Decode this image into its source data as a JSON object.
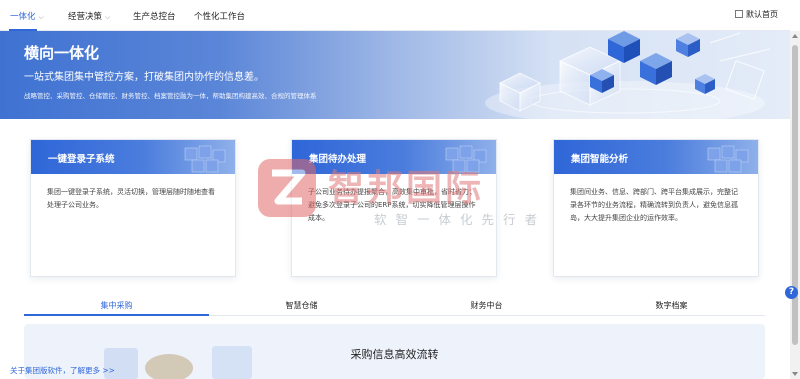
{
  "topnav": {
    "tabs": [
      {
        "label": "一体化",
        "has_dropdown": true,
        "active": true
      },
      {
        "label": "经营决策",
        "has_dropdown": true,
        "active": false
      },
      {
        "label": "生产总控台",
        "has_dropdown": false,
        "active": false
      },
      {
        "label": "个性化工作台",
        "has_dropdown": false,
        "active": false
      }
    ],
    "default_home_label": "默认首页",
    "default_home_checked": false
  },
  "hero": {
    "title": "横向一体化",
    "subtitle": "一站式集团集中管控方案，打破集团内协作的信息差。",
    "description": "战略管控、采购管控、仓储管控、财务管控、档案管控融为一体，帮助集团构建高效、合规的管理体系"
  },
  "cards": [
    {
      "title": "一键登录子系统",
      "text": "集团一键登录子系统，灵活切换，管理层随时随地查看处理子公司业务。"
    },
    {
      "title": "集团待办处理",
      "text": "子公司业务待办提报聚合，高效集中审批，省时省力；避免多次登录子公司的ERP系统，切实降低管理层操作成本。"
    },
    {
      "title": "集团智能分析",
      "text": "集团间业务、信息、跨部门、跨平台集成展示，完整记录各环节的业务流程，精确流转到负责人，避免信息孤岛，大大提升集团企业的运作效率。"
    }
  ],
  "watermark": {
    "brand": "智邦国际",
    "slogan": "软智一体化先行者"
  },
  "subtabs": [
    {
      "label": "集中采购",
      "active": true
    },
    {
      "label": "智慧仓储",
      "active": false
    },
    {
      "label": "财务中台",
      "active": false
    },
    {
      "label": "数字档案",
      "active": false
    }
  ],
  "panel": {
    "title": "采购信息高效流转"
  },
  "footer": {
    "link": "关于集团版软件，了解更多 >>"
  },
  "help": {
    "label": "?"
  },
  "colors": {
    "accent": "#2f66d8",
    "watermark_red": "#e07a7a",
    "hero_blue": "#3f72d2"
  },
  "icons": [
    "chevron-down-icon",
    "checkbox-icon",
    "help-icon",
    "cube-cluster-icon",
    "brand-logo-icon"
  ]
}
